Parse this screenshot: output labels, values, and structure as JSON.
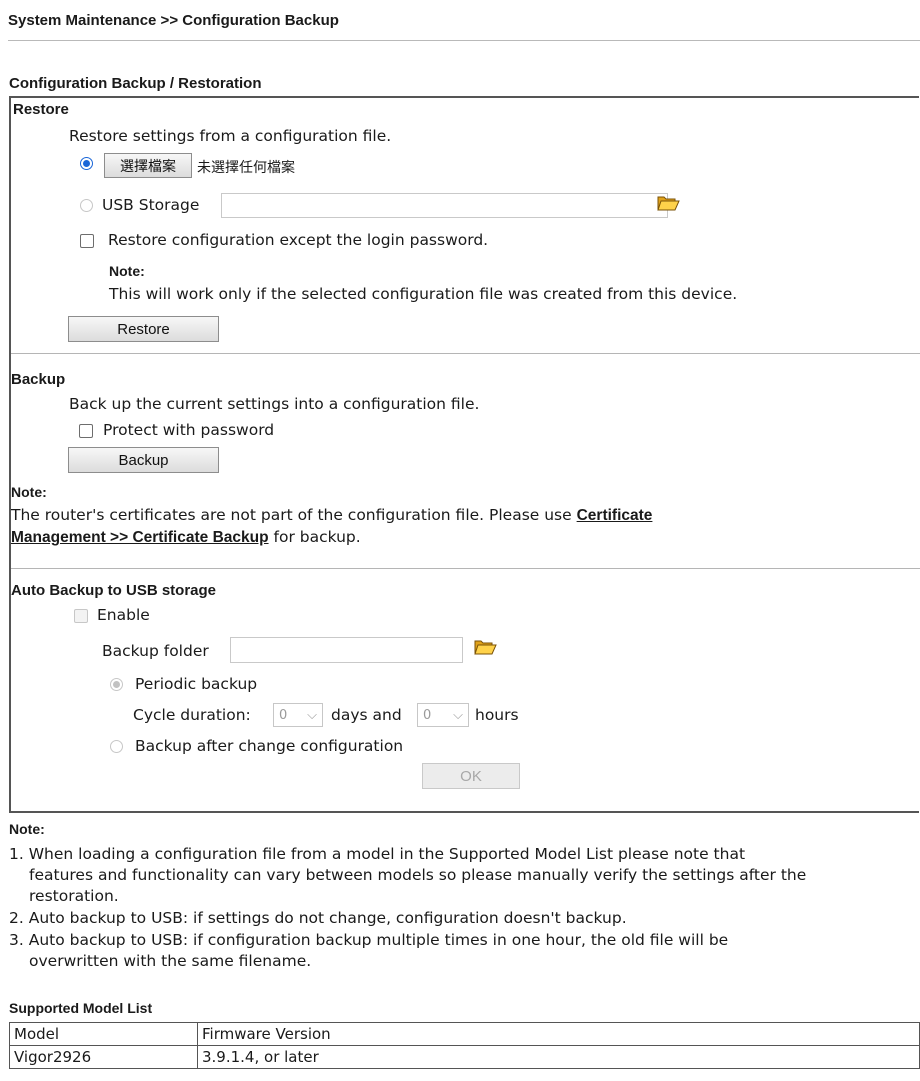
{
  "page": {
    "breadcrumb": "System Maintenance >> Configuration Backup",
    "section_title": "Configuration Backup / Restoration"
  },
  "restore": {
    "heading": "Restore",
    "description": "Restore settings from a configuration file.",
    "choose_file_button": "選擇檔案",
    "no_file_text": "未選擇任何檔案",
    "usb_storage_label": "USB Storage",
    "usb_storage_value": "",
    "except_password_label": "Restore configuration except the login password.",
    "note_heading": "Note:",
    "note_text": "This will work only if the selected configuration file was created from this device.",
    "button": "Restore"
  },
  "backup": {
    "heading": "Backup",
    "description": "Back up the current settings into a configuration file.",
    "protect_label": "Protect with password",
    "button": "Backup",
    "note_heading": "Note:",
    "note_text_1": "The router's certificates are not part of the configuration file. Please use",
    "note_link": "Certificate",
    "note_link_2": "Management >> Certificate Backup",
    "note_text_2": "for backup."
  },
  "auto_backup": {
    "heading": "Auto Backup to USB storage",
    "enable_label": "Enable",
    "folder_label": "Backup folder",
    "folder_value": "",
    "periodic_label": "Periodic backup",
    "cycle_label": "Cycle duration:",
    "days_value": "0",
    "days_label": "days and",
    "hours_value": "0",
    "hours_label": "hours",
    "after_change_label": "Backup after change configuration",
    "ok_button": "OK"
  },
  "notes": {
    "heading": "Note:",
    "item1_line1": "1. When loading a configuration file from a model in the Supported Model List please note that",
    "item1_line2": "features and functionality can vary between models so please manually verify the settings after the",
    "item1_line3": "restoration.",
    "item2": "2. Auto backup to USB: if settings do not change, configuration doesn't backup.",
    "item3_line1": "3. Auto backup to USB: if configuration backup multiple times in one hour, the old file will be",
    "item3_line2": "overwritten with the same filename."
  },
  "models": {
    "heading": "Supported Model List",
    "col_model": "Model",
    "col_firmware": "Firmware Version",
    "rows": [
      {
        "model": "Vigor2926",
        "firmware": "3.9.1.4, or later"
      }
    ]
  }
}
